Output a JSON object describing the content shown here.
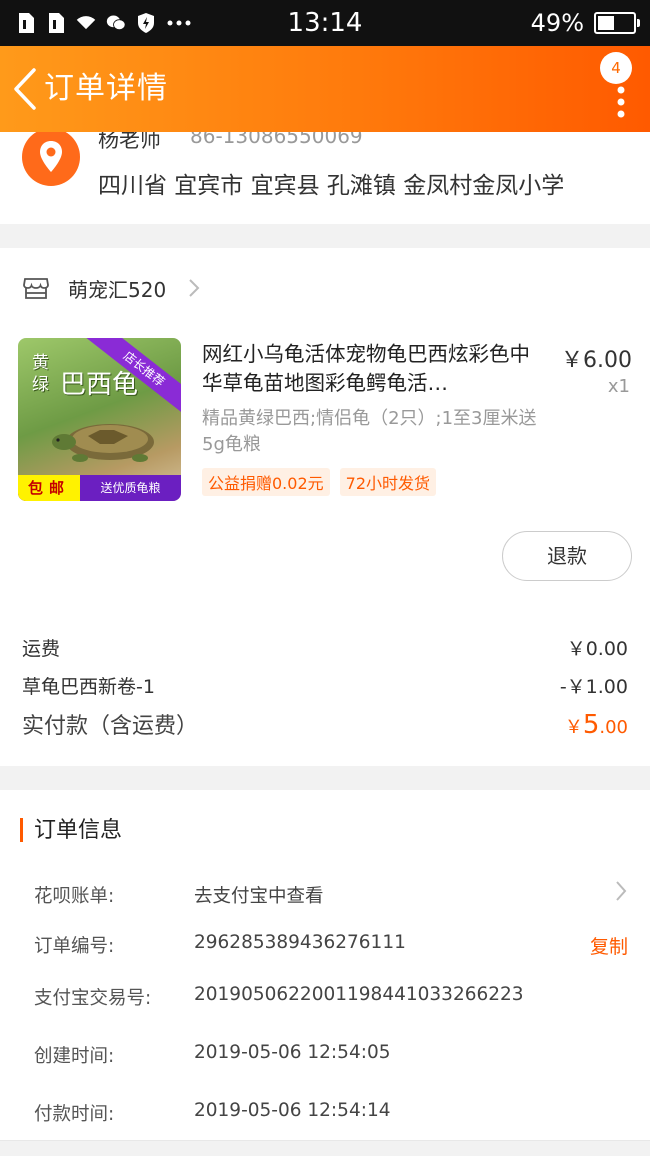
{
  "status_bar": {
    "time": "13:14",
    "battery": "49%"
  },
  "nav": {
    "title": "订单详情",
    "badge": "4"
  },
  "address": {
    "name": "杨老师",
    "phone": "86-13086550069",
    "text": "四川省 宜宾市 宜宾县 孔滩镇 金凤村金凤小学"
  },
  "store": {
    "name": "萌宠汇520"
  },
  "product": {
    "title": "网红小乌龟活体宠物龟巴西炫彩色中华草龟苗地图彩龟鳄龟活…",
    "price": "￥6.00",
    "qty": "x1",
    "sku": "精品黄绿巴西;情侣龟（2只）;1至3厘米送5g龟粮",
    "tags": [
      "公益捐赠0.02元",
      "72小时发货"
    ],
    "image": {
      "ribbon": "店长推荐",
      "side": "黄绿",
      "big": "巴西龟",
      "strip_left": "包邮",
      "strip_right": "送优质龟粮"
    },
    "refund_label": "退款"
  },
  "fees": {
    "shipping_label": "运费",
    "shipping_value": "￥0.00",
    "coupon_label": "草龟巴西新卷-1",
    "coupon_value": "-￥1.00",
    "total_label": "实付款（含运费）",
    "total_currency": "￥",
    "total_int": "5",
    "total_dec": ".00"
  },
  "order_info": {
    "title": "订单信息",
    "rows": [
      {
        "label": "花呗账单:",
        "value": "去支付宝中查看"
      },
      {
        "label": "订单编号:",
        "value": "296285389436276111",
        "action": "复制"
      },
      {
        "label": "支付宝交易号:",
        "value": "2019050622001198441033266223"
      },
      {
        "label": "创建时间:",
        "value": "2019-05-06 12:54:05"
      },
      {
        "label": "付款时间:",
        "value": "2019-05-06 12:54:14"
      }
    ]
  },
  "colors": {
    "accent": "#ff5a00",
    "nav_start": "#ff9a1a",
    "nav_end": "#ff5a00"
  }
}
